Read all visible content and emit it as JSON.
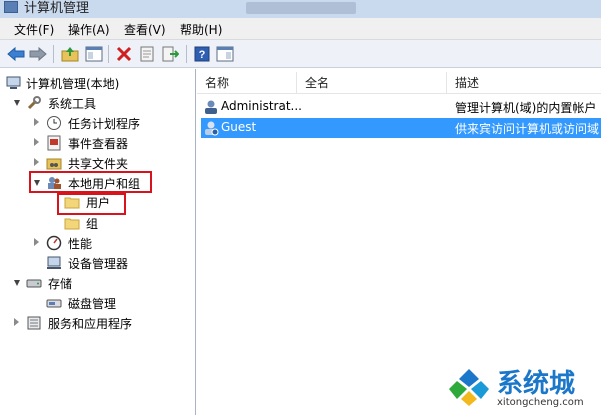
{
  "window": {
    "title": "计算机管理"
  },
  "menubar": {
    "items": [
      "文件(F)",
      "操作(A)",
      "查看(V)",
      "帮助(H)"
    ]
  },
  "toolbar": {
    "buttons": [
      "back-arrow-icon",
      "forward-arrow-icon",
      "up-folder-icon",
      "show-hide-tree-icon",
      "delete-icon",
      "properties-icon",
      "export-list-icon",
      "help-icon",
      "action-pane-icon"
    ]
  },
  "tree": {
    "root": "计算机管理(本地)",
    "system_tools": "系统工具",
    "task_scheduler": "任务计划程序",
    "event_viewer": "事件查看器",
    "shared_folders": "共享文件夹",
    "local_users_groups": "本地用户和组",
    "users": "用户",
    "groups": "组",
    "performance": "性能",
    "device_manager": "设备管理器",
    "storage": "存储",
    "disk_management": "磁盘管理",
    "services_apps": "服务和应用程序"
  },
  "list": {
    "columns": {
      "name": "名称",
      "fullname": "全名",
      "description": "描述"
    },
    "rows": [
      {
        "name": "Administrat...",
        "fullname": "",
        "description": "管理计算机(域)的内置帐户",
        "selected": false
      },
      {
        "name": "Guest",
        "fullname": "",
        "description": "供来宾访问计算机或访问域",
        "selected": true
      }
    ]
  },
  "watermark": {
    "text": "系统城",
    "sub": "xitongcheng.com"
  },
  "colors": {
    "selection": "#3399ff",
    "highlight_box": "#d7141c",
    "watermark": "#1a77c9"
  }
}
